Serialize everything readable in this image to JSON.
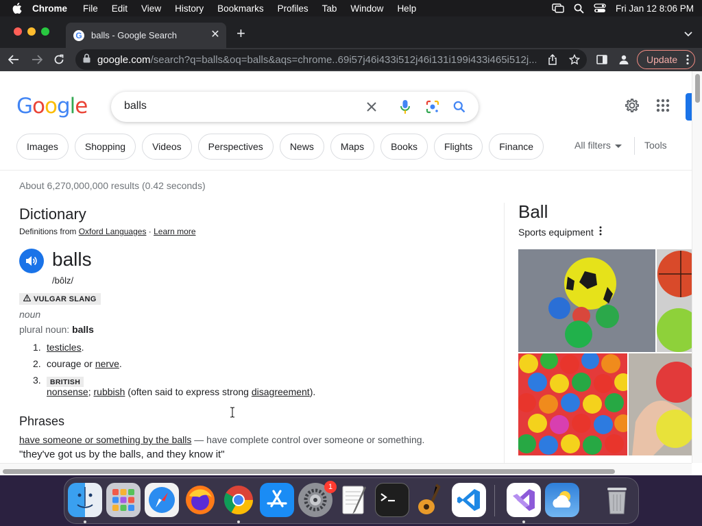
{
  "menubar": {
    "items": [
      "Chrome",
      "File",
      "Edit",
      "View",
      "History",
      "Bookmarks",
      "Profiles",
      "Tab",
      "Window",
      "Help"
    ],
    "clock": "Fri Jan 12  8:06 PM"
  },
  "browser": {
    "tab_title": "balls - Google Search",
    "url_host": "google.com",
    "url_path": "/search?q=balls&oq=balls&aqs=chrome..69i57j46i433i512j46i131i199i433i465i512j...",
    "update_label": "Update"
  },
  "google": {
    "query": "balls",
    "chips": [
      "Images",
      "Shopping",
      "Videos",
      "Perspectives",
      "News",
      "Maps",
      "Books",
      "Flights",
      "Finance"
    ],
    "all_filters": "All filters",
    "tools": "Tools",
    "stats": "About 6,270,000,000 results (0.42 seconds)"
  },
  "dictionary": {
    "title": "Dictionary",
    "source_prefix": "Definitions from ",
    "source_link": "Oxford Languages",
    "source_sep": " · ",
    "learn_more": "Learn more",
    "word": "balls",
    "phonetic": "/bôlz/",
    "register": "VULGAR SLANG",
    "pos": "noun",
    "plural_label": "plural noun: ",
    "plural_value": "balls",
    "def1_num": "1.",
    "def1_link": "testicles",
    "def1_tail": ".",
    "def2_num": "2.",
    "def2_head": "courage or ",
    "def2_link": "nerve",
    "def2_tail": ".",
    "def3_num": "3.",
    "def3_tag": "BRITISH",
    "def3_link1": "nonsense",
    "def3_sep": "; ",
    "def3_link2": "rubbish",
    "def3_mid": " (often said to express strong ",
    "def3_link3": "disagreement",
    "def3_tail": ").",
    "phrases_title": "Phrases",
    "phrase_link": "have someone or something by the balls",
    "phrase_def": " — have complete control over someone or something.",
    "example": "\"they've got us by the balls, and they know it\""
  },
  "knowledge_panel": {
    "title": "Ball",
    "subtitle": "Sports equipment"
  },
  "colors": {
    "google_blue": "#4285f4",
    "google_red": "#ea4335",
    "google_yellow": "#fbbc05",
    "google_green": "#34a853",
    "accent": "#1a73e8"
  },
  "dock": {
    "apps": [
      "finder-icon",
      "launchpad-icon",
      "safari-icon",
      "firefox-icon",
      "chrome-icon",
      "app-store-icon",
      "system-settings-icon",
      "textedit-icon",
      "terminal-icon",
      "garageband-icon",
      "vscode-icon",
      "visual-studio-icon",
      "weather-icon",
      "trash-icon"
    ],
    "settings_badge": "1"
  }
}
